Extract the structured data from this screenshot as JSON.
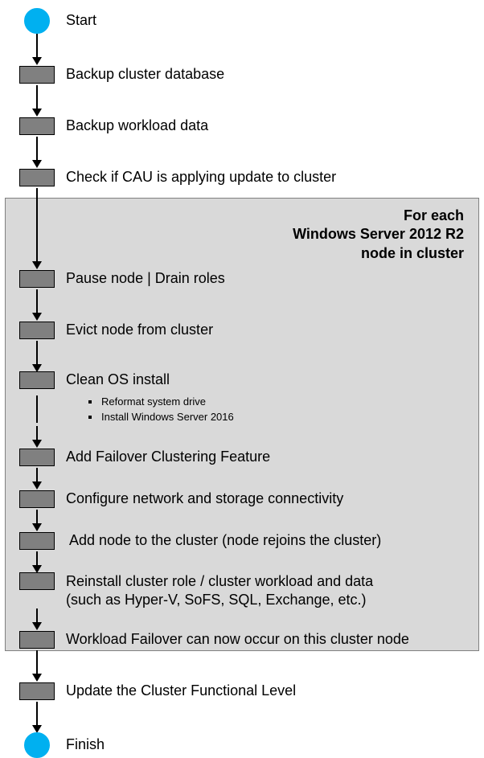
{
  "start_label": "Start",
  "finish_label": "Finish",
  "steps_pre": [
    "Backup cluster database",
    "Backup workload data",
    "Check if CAU is applying update to cluster"
  ],
  "box_caption_lines": [
    "For each",
    "Windows Server 2012 R2",
    "node in cluster"
  ],
  "steps_box": [
    {
      "label": "Pause node | Drain roles"
    },
    {
      "label": "Evict node from cluster"
    },
    {
      "label": "Clean OS install",
      "bullets": [
        "Reformat system drive",
        "Install Windows Server 2016"
      ]
    },
    {
      "label": "Add Failover Clustering Feature"
    },
    {
      "label": "Configure network and storage connectivity"
    },
    {
      "label": "Add node to the cluster (node rejoins the cluster)"
    },
    {
      "label_lines": [
        "Reinstall cluster role / cluster workload and data",
        "(such as Hyper-V, SoFS, SQL, Exchange, etc.)"
      ]
    },
    {
      "label": "Workload Failover can now occur on this cluster node"
    }
  ],
  "steps_post": [
    "Update the Cluster Functional Level"
  ]
}
